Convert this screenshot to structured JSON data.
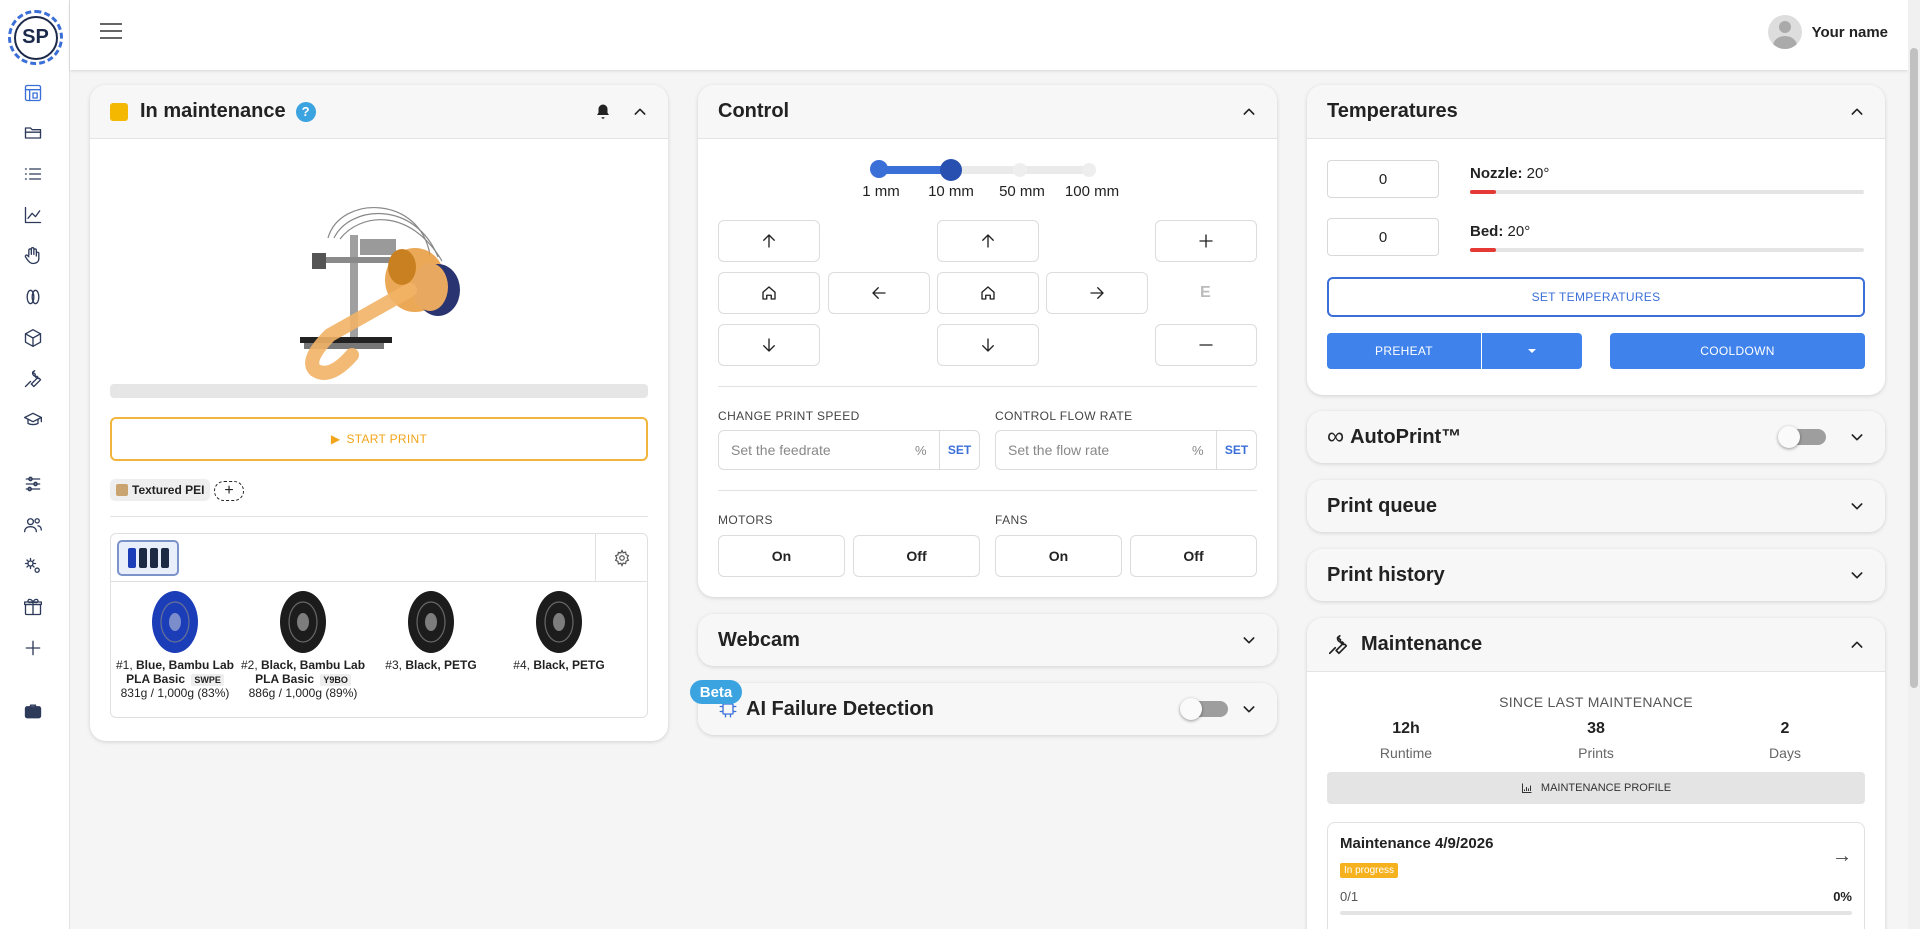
{
  "app": {
    "logo_text": "SP"
  },
  "sidebar": {
    "items": [
      {
        "icon": "printer-icon",
        "active": true
      },
      {
        "icon": "folder-icon"
      },
      {
        "icon": "list-icon"
      },
      {
        "icon": "chart-icon"
      },
      {
        "icon": "hand-icon"
      },
      {
        "icon": "spool-icon"
      },
      {
        "icon": "cube-icon"
      },
      {
        "icon": "wrench-icon"
      },
      {
        "icon": "graduation-cap-icon"
      },
      {
        "icon": "sliders-icon"
      },
      {
        "icon": "users-icon"
      },
      {
        "icon": "gears-icon"
      },
      {
        "icon": "gift-icon"
      },
      {
        "icon": "plus-icon"
      },
      {
        "icon": "briefcase-icon"
      }
    ]
  },
  "header": {
    "user_name": "Your name"
  },
  "status_card": {
    "title": "In maintenance",
    "help": "?",
    "status_color": "#f5b800",
    "start_print": "START PRINT",
    "print_progress": 0,
    "plate": "Textured PEI",
    "plate_add": "+",
    "spools": [
      {
        "num": "#1",
        "name": "Blue, Bambu Lab PLA Basic",
        "tag": "SWPE",
        "weight": "831g / 1,000g (83%)",
        "color": "#1b3db8"
      },
      {
        "num": "#2",
        "name": "Black, Bambu Lab PLA Basic",
        "tag": "Y9BO",
        "weight": "886g / 1,000g (89%)",
        "color": "#1c1c1c"
      },
      {
        "num": "#3",
        "name": "Black, PETG",
        "tag": "",
        "weight": "",
        "color": "#1c1c1c"
      },
      {
        "num": "#4",
        "name": "Black, PETG",
        "tag": "",
        "weight": "",
        "color": "#1c1c1c"
      }
    ]
  },
  "control": {
    "title": "Control",
    "steps": [
      "1 mm",
      "10 mm",
      "50 mm",
      "100 mm"
    ],
    "selected_step": "10 mm",
    "e_label": "E",
    "print_speed_label": "CHANGE PRINT SPEED",
    "print_speed_placeholder": "Set the feedrate",
    "flow_rate_label": "CONTROL FLOW RATE",
    "flow_rate_placeholder": "Set the flow rate",
    "pct": "%",
    "set": "SET",
    "motors_label": "MOTORS",
    "fans_label": "FANS",
    "on": "On",
    "off": "Off"
  },
  "webcam": {
    "title": "Webcam"
  },
  "ai": {
    "title": "AI Failure Detection",
    "beta": "Beta",
    "enabled": false
  },
  "temperatures": {
    "title": "Temperatures",
    "nozzle_value": "0",
    "nozzle_label": "Nozzle:",
    "nozzle_temp": "20°",
    "bed_value": "0",
    "bed_label": "Bed:",
    "bed_temp": "20°",
    "set_btn": "SET TEMPERATURES",
    "preheat_btn": "PREHEAT",
    "cooldown_btn": "COOLDOWN"
  },
  "autoprint": {
    "title": "AutoPrint™",
    "enabled": false
  },
  "print_queue": {
    "title": "Print queue"
  },
  "print_history": {
    "title": "Print history"
  },
  "maintenance": {
    "title": "Maintenance",
    "since_label": "SINCE LAST MAINTENANCE",
    "stats": [
      {
        "value": "12h",
        "label": "Runtime"
      },
      {
        "value": "38",
        "label": "Prints"
      },
      {
        "value": "2",
        "label": "Days"
      }
    ],
    "profile_btn": "MAINTENANCE PROFILE",
    "task_title": "Maintenance 4/9/2026",
    "task_status": "In progress",
    "task_count": "0/1",
    "task_pct": "0%"
  },
  "colors": {
    "accent": "#3b6fd8",
    "warning": "#f5b800",
    "danger": "#e53935"
  }
}
